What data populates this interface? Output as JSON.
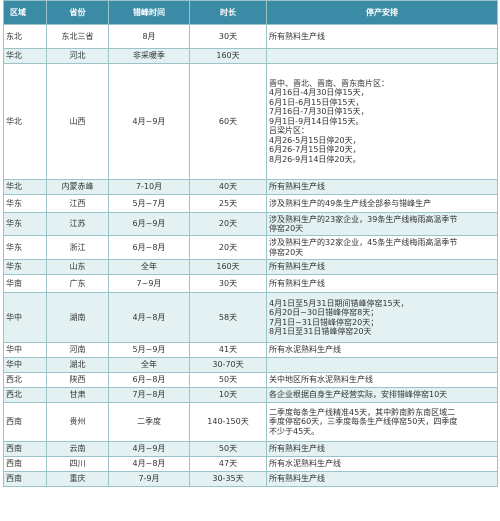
{
  "headers": [
    "区域",
    "省份",
    "错峰时间",
    "时长",
    "停产安排"
  ],
  "rows": [
    {
      "region": "东北",
      "province": "东北三省",
      "time": "8月",
      "duration": "30天",
      "plan": [
        "所有熟料生产线"
      ]
    },
    {
      "region": "华北",
      "province": "河北",
      "time": "非采暖季",
      "duration": "160天",
      "plan": [
        ""
      ]
    },
    {
      "region": "华北",
      "province": "山西",
      "time": "4月~9月",
      "duration": "60天",
      "plan": [
        "晋中、晋北、晋南、晋东南片区：",
        "4月16日-4月30日停15天，",
        "6月1日-6月15日停15天，",
        "7月16日-7月30日停15天，",
        "9月1日-9月14日停15天。",
        "吕梁片区：",
        "4月26-5月15日停20天，",
        "6月26-7月15日停20天，",
        "8月26-9月14日停20天。"
      ]
    },
    {
      "region": "华北",
      "province": "内蒙赤峰",
      "time": "7-10月",
      "duration": "40天",
      "plan": [
        "所有熟料生产线"
      ]
    },
    {
      "region": "华东",
      "province": "江西",
      "time": "5月~7月",
      "duration": "25天",
      "plan": [
        "涉及熟料生产的49条生产线全部参与错峰生产"
      ]
    },
    {
      "region": "华东",
      "province": "江苏",
      "time": "6月~9月",
      "duration": "20天",
      "plan": [
        "涉及熟料生产的23家企业，39条生产线梅雨高温季节",
        "停窑20天"
      ]
    },
    {
      "region": "华东",
      "province": "浙江",
      "time": "6月~8月",
      "duration": "20天",
      "plan": [
        "涉及熟料生产的32家企业，45条生产线梅雨高温季节",
        "停窑20天"
      ]
    },
    {
      "region": "华东",
      "province": "山东",
      "time": "全年",
      "duration": "160天",
      "plan": [
        "所有熟料生产线"
      ]
    },
    {
      "region": "华南",
      "province": "广东",
      "time": "7~9月",
      "duration": "30天",
      "plan": [
        "所有熟料生产线"
      ]
    },
    {
      "region": "华中",
      "province": "湖南",
      "time": "4月~8月",
      "duration": "58天",
      "plan": [
        "4月1日至5月31日期间错峰停窑15天，",
        "6月20日~30日错峰停窑8天；",
        "7月1日~31日错峰停窑20天；",
        "8月1日至31日错峰停窑20天"
      ]
    },
    {
      "region": "华中",
      "province": "河南",
      "time": "5月~9月",
      "duration": "41天",
      "plan": [
        "所有水泥熟料生产线"
      ]
    },
    {
      "region": "华中",
      "province": "湖北",
      "time": "全年",
      "duration": "30-70天",
      "plan": [
        ""
      ]
    },
    {
      "region": "西北",
      "province": "陕西",
      "time": "6月~8月",
      "duration": "50天",
      "plan": [
        "关中地区所有水泥熟料生产线"
      ]
    },
    {
      "region": "西北",
      "province": "甘肃",
      "time": "7月~8月",
      "duration": "10天",
      "plan": [
        "各企业根据自身生产经营实际，安排错峰停窑10天"
      ]
    },
    {
      "region": "西南",
      "province": "贵州",
      "time": "二季度",
      "duration": "140-150天",
      "plan": [
        "二季度每条生产线精准45天，其中黔南黔东南区域二",
        "季度停窑60天，三季度每条生产线停窑50天，四季度",
        "不少于45天。"
      ]
    },
    {
      "region": "西南",
      "province": "云南",
      "time": "4月~9月",
      "duration": "50天",
      "plan": [
        "所有熟料生产线"
      ]
    },
    {
      "region": "西南",
      "province": "四川",
      "time": "4月~8月",
      "duration": "47天",
      "plan": [
        "所有水泥熟料生产线"
      ]
    },
    {
      "region": "西南",
      "province": "重庆",
      "time": "7-9月",
      "duration": "30-35天",
      "plan": [
        "所有熟料生产线"
      ]
    }
  ]
}
